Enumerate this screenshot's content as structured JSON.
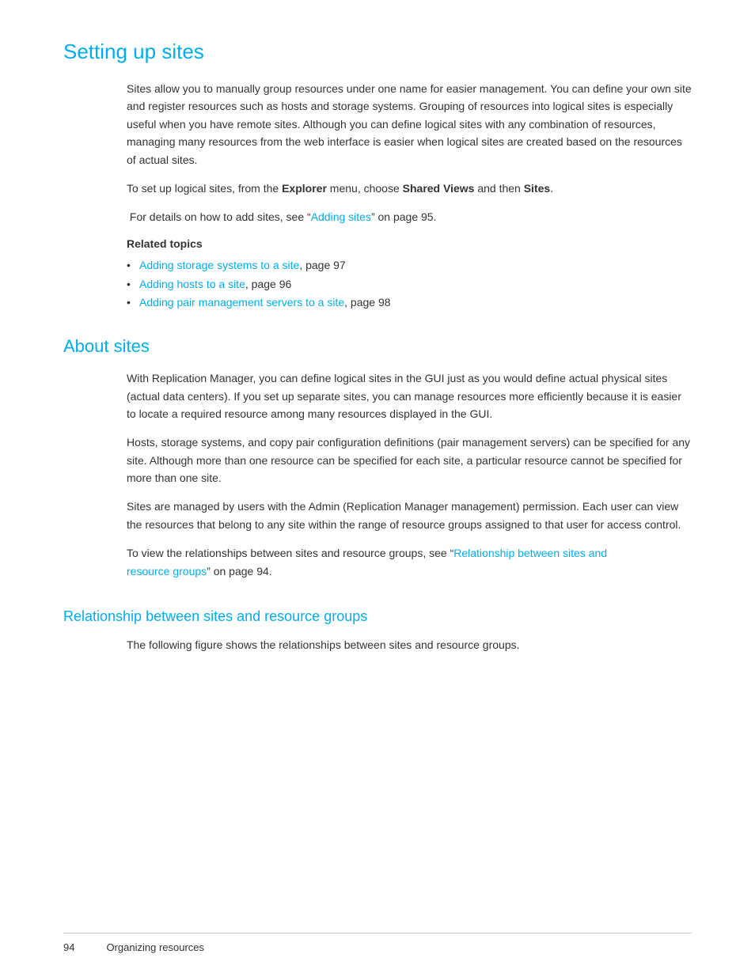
{
  "page": {
    "title": "Setting up sites",
    "sections": {
      "intro": {
        "paragraph1": "Sites allow you to manually group resources under one name for easier management. You can define your own site and register resources such as hosts and storage systems. Grouping of resources into logical sites is especially useful when you have remote sites. Although you can define logical sites with any combination of resources, managing many resources from the web interface is easier when logical sites are created based on the resources of actual sites.",
        "paragraph2_prefix": "To set up logical sites, from the ",
        "paragraph2_bold1": "Explorer",
        "paragraph2_mid": " menu, choose ",
        "paragraph2_bold2": "Shared Views",
        "paragraph2_suffix": " and then ",
        "paragraph2_bold3": "Sites",
        "paragraph2_end": ".",
        "paragraph3_prefix": "For details on how to add sites, see “",
        "paragraph3_link": "Adding sites",
        "paragraph3_suffix": "” on page 95.",
        "related_topics_label": "Related topics",
        "bullets": [
          {
            "link_text": "Adding storage systems to a site",
            "suffix": ", page 97"
          },
          {
            "link_text": "Adding hosts to a site",
            "suffix": ", page 96"
          },
          {
            "link_text": "Adding pair management servers to a site",
            "suffix": ", page 98"
          }
        ]
      },
      "about_sites": {
        "title": "About sites",
        "paragraph1": "With Replication Manager, you can define logical sites in the GUI just as you would define actual physical sites (actual data centers). If you set up separate sites, you can manage resources more efficiently because it is easier to locate a required resource among many resources displayed in the GUI.",
        "paragraph2": "Hosts, storage systems, and copy pair configuration definitions (pair management servers) can be specified for any site. Although more than one resource can be specified for each site, a particular resource cannot be specified for more than one site.",
        "paragraph3": "Sites are managed by users with the Admin (Replication Manager management) permission. Each user can view the resources that belong to any site within the range of resource groups assigned to that user for access control.",
        "paragraph4_prefix": "To view the relationships between sites and resource groups, see “",
        "paragraph4_link": "Relationship between sites and resource groups",
        "paragraph4_suffix": "” on page 94."
      },
      "relationship": {
        "title": "Relationship between sites and resource groups",
        "paragraph1": "The following figure shows the relationships between sites and resource groups."
      }
    },
    "footer": {
      "page_number": "94",
      "label": "Organizing resources"
    }
  }
}
